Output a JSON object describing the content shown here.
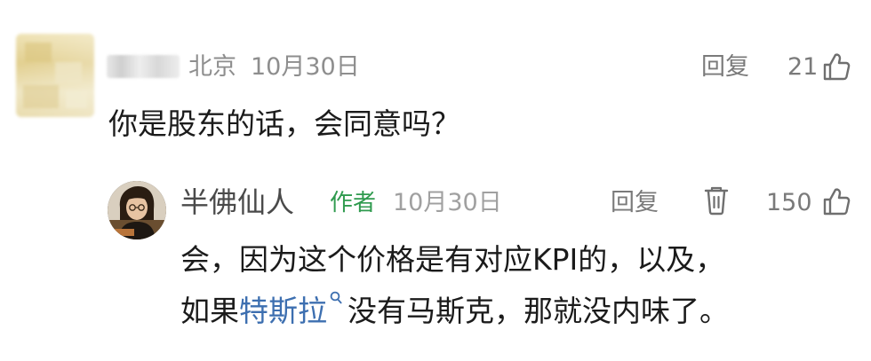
{
  "comment": {
    "location": "北京",
    "date": "10月30日",
    "reply_label": "回复",
    "likes": "21",
    "text": "你是股东的话，会同意吗？"
  },
  "reply": {
    "username": "半佛仙人",
    "badge": "作者",
    "date": "10月30日",
    "reply_label": "回复",
    "likes": "150",
    "line1": "会，因为这个价格是有对应KPI的，以及，",
    "line2_prefix": "如果",
    "line2_link": "特斯拉",
    "line2_suffix": "没有马斯克，那就没内味了。"
  },
  "colors": {
    "link": "#3d6fb0",
    "author_badge": "#2f9a4e",
    "meta_gray": "#8e8e8e"
  },
  "icons": {
    "comment_like": "thumbs-up-icon",
    "reply_like": "thumbs-up-icon",
    "reply_delete": "trash-icon",
    "link_search": "search-icon"
  }
}
